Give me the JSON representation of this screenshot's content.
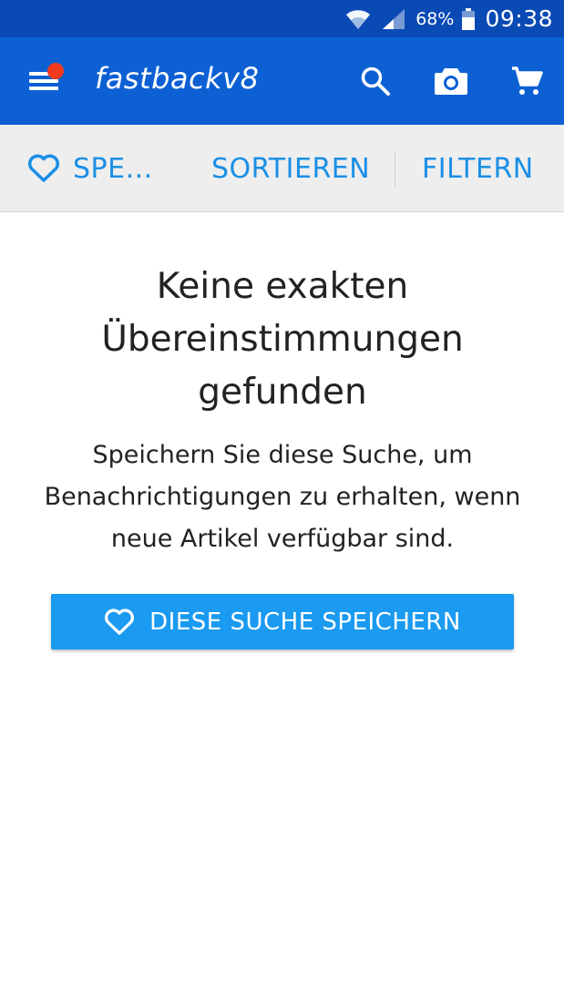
{
  "status_bar": {
    "battery_percent": "68%",
    "time": "09:38"
  },
  "app_bar": {
    "title": "fastbackv8",
    "icons": [
      "menu-icon",
      "search-icon",
      "camera-icon",
      "cart-icon"
    ],
    "notification_dot_color": "#f23a1f"
  },
  "toolbar": {
    "save_label": "SPE...",
    "sort_label": "SORTIEREN",
    "filter_label": "FILTERN"
  },
  "empty_state": {
    "headline": "Keine exakten Übereinstimmungen gefunden",
    "description": "Speichern Sie diese Suche, um Benachrichtigungen zu erhalten, wenn neue Artikel verfügbar sind.",
    "button_label": "DIESE SUCHE SPEICHERN"
  },
  "colors": {
    "status_bar": "#0a4ab5",
    "app_bar": "#0c60d4",
    "accent": "#1a8fe6",
    "button": "#1a9af0"
  }
}
